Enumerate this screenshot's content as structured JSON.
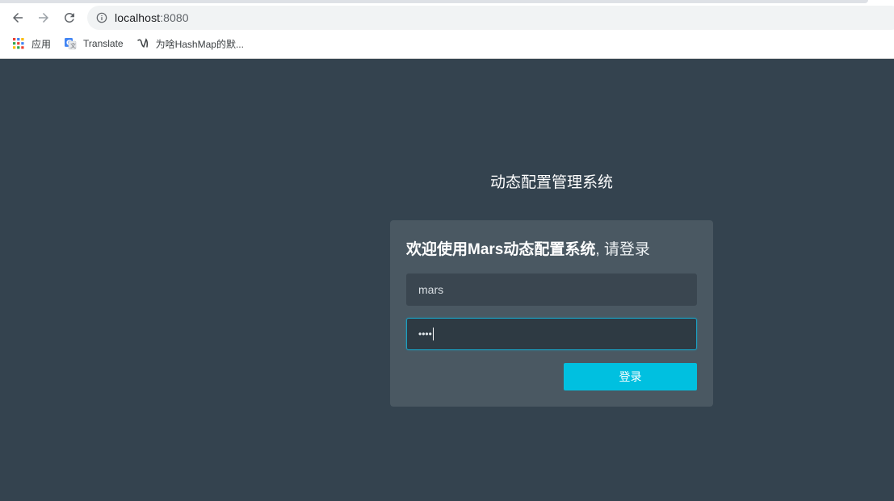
{
  "browser": {
    "url_host": "localhost",
    "url_port": ":8080",
    "bookmarks": [
      {
        "label": "应用",
        "icon": "apps-grid-icon"
      },
      {
        "label": "Translate",
        "icon": "google-translate-icon"
      },
      {
        "label": "为啥HashMap的默...",
        "icon": "bookmark-favicon"
      }
    ]
  },
  "page": {
    "site_title": "动态配置管理系统",
    "login": {
      "heading_bold": "欢迎使用Mars动态配置系统",
      "heading_rest": ", 请登录",
      "username_value": "mars",
      "password_mask": "••••",
      "submit_label": "登录"
    }
  },
  "colors": {
    "page_background": "#34434f",
    "card_background": "#4a5862",
    "accent": "#00c0e0",
    "focus_border": "#1b9ec0"
  }
}
